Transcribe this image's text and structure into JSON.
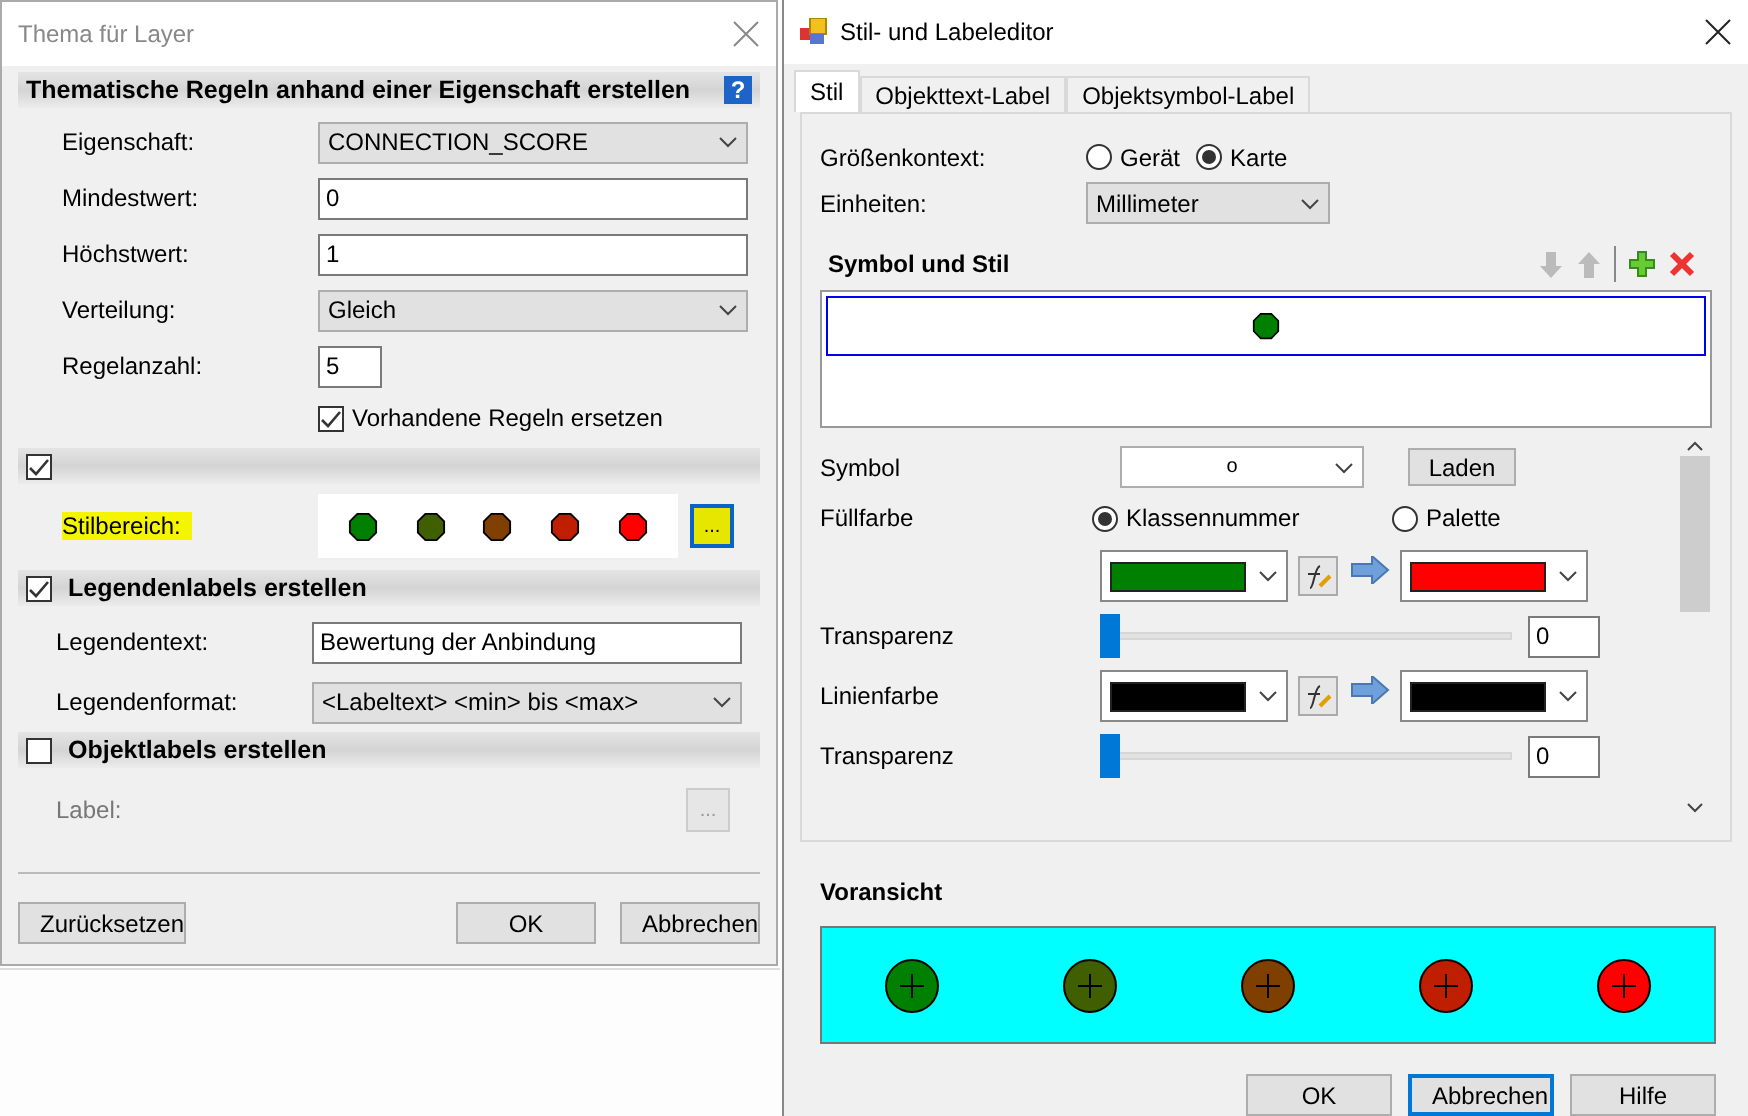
{
  "left_window": {
    "title": "Thema für Layer",
    "header": "Thematische Regeln anhand einer Eigenschaft erstellen",
    "help": "?",
    "fields": [
      {
        "kind": "select",
        "label": "Eigenschaft:",
        "value": "CONNECTION_SCORE"
      },
      {
        "kind": "input",
        "label": "Mindestwert:",
        "value": "0"
      },
      {
        "kind": "input",
        "label": "Höchstwert:",
        "value": "1"
      },
      {
        "kind": "select",
        "label": "Verteilung:",
        "value": "Gleich"
      },
      {
        "kind": "short",
        "label": "Regelanzahl:",
        "value": "5"
      }
    ],
    "replace_rules": {
      "label": "Vorhandene Regeln ersetzen",
      "checked": true
    },
    "style_section": {
      "checked": true,
      "label": "Stilbereich:",
      "button": "...",
      "swatches": [
        {
          "color": "#008000"
        },
        {
          "color": "#3f5f00"
        },
        {
          "color": "#7f3f00"
        },
        {
          "color": "#bf1f00"
        },
        {
          "color": "#ff0000"
        }
      ]
    },
    "legend_section": {
      "title": "Legendenlabels erstellen",
      "checked": true,
      "fields": [
        {
          "kind": "input",
          "label": "Legendentext:",
          "value": "Bewertung der Anbindung"
        },
        {
          "kind": "select",
          "label": "Legendenformat:",
          "value": "<Labeltext> <min> bis <max>"
        }
      ]
    },
    "label_section": {
      "title": "Objektlabels erstellen",
      "checked": false,
      "label": "Label:",
      "button": "..."
    },
    "buttons": [
      {
        "label": "Zurücksetzen"
      },
      {
        "label": "OK"
      },
      {
        "label": "Abbrechen"
      }
    ]
  },
  "right_window": {
    "title": "Stil- und Labeleditor",
    "tabs": [
      {
        "label": "Stil",
        "selected": true
      },
      {
        "label": "Objekttext-Label",
        "selected": false
      },
      {
        "label": "Objektsymbol-Label",
        "selected": false
      }
    ],
    "size_context": {
      "label": "Größenkontext:",
      "options": [
        {
          "label": "Gerät",
          "selected": false
        },
        {
          "label": "Karte",
          "selected": true
        }
      ]
    },
    "units": {
      "label": "Einheiten:",
      "value": "Millimeter"
    },
    "symbol_style": {
      "title": "Symbol und Stil",
      "items": [
        {
          "color": "#008000",
          "selected": true
        }
      ]
    },
    "symbol": {
      "label": "Symbol",
      "value": "o",
      "button": "Laden"
    },
    "fill": {
      "label": "Füllfarbe",
      "options": [
        {
          "label": "Klassennummer",
          "selected": true
        },
        {
          "label": "Palette",
          "selected": false
        }
      ],
      "colors": [
        {
          "color": "#008000"
        },
        {
          "color": "#ff0000"
        }
      ]
    },
    "fill_transparency": {
      "label": "Transparenz",
      "level": 0,
      "value": "0"
    },
    "line": {
      "label": "Linienfarbe",
      "colors": [
        {
          "color": "#000000"
        },
        {
          "color": "#000000"
        }
      ]
    },
    "line_transparency": {
      "label": "Transparenz",
      "level": 0,
      "value": "0"
    },
    "preview": {
      "title": "Voransicht",
      "items": [
        {
          "color": "#008000"
        },
        {
          "color": "#3f5f00"
        },
        {
          "color": "#7f3f00"
        },
        {
          "color": "#bf1f00"
        },
        {
          "color": "#ff0000"
        }
      ]
    },
    "buttons": [
      {
        "label": "OK",
        "selected": false
      },
      {
        "label": "Abbrechen",
        "selected": true
      },
      {
        "label": "Hilfe",
        "selected": false
      }
    ]
  }
}
